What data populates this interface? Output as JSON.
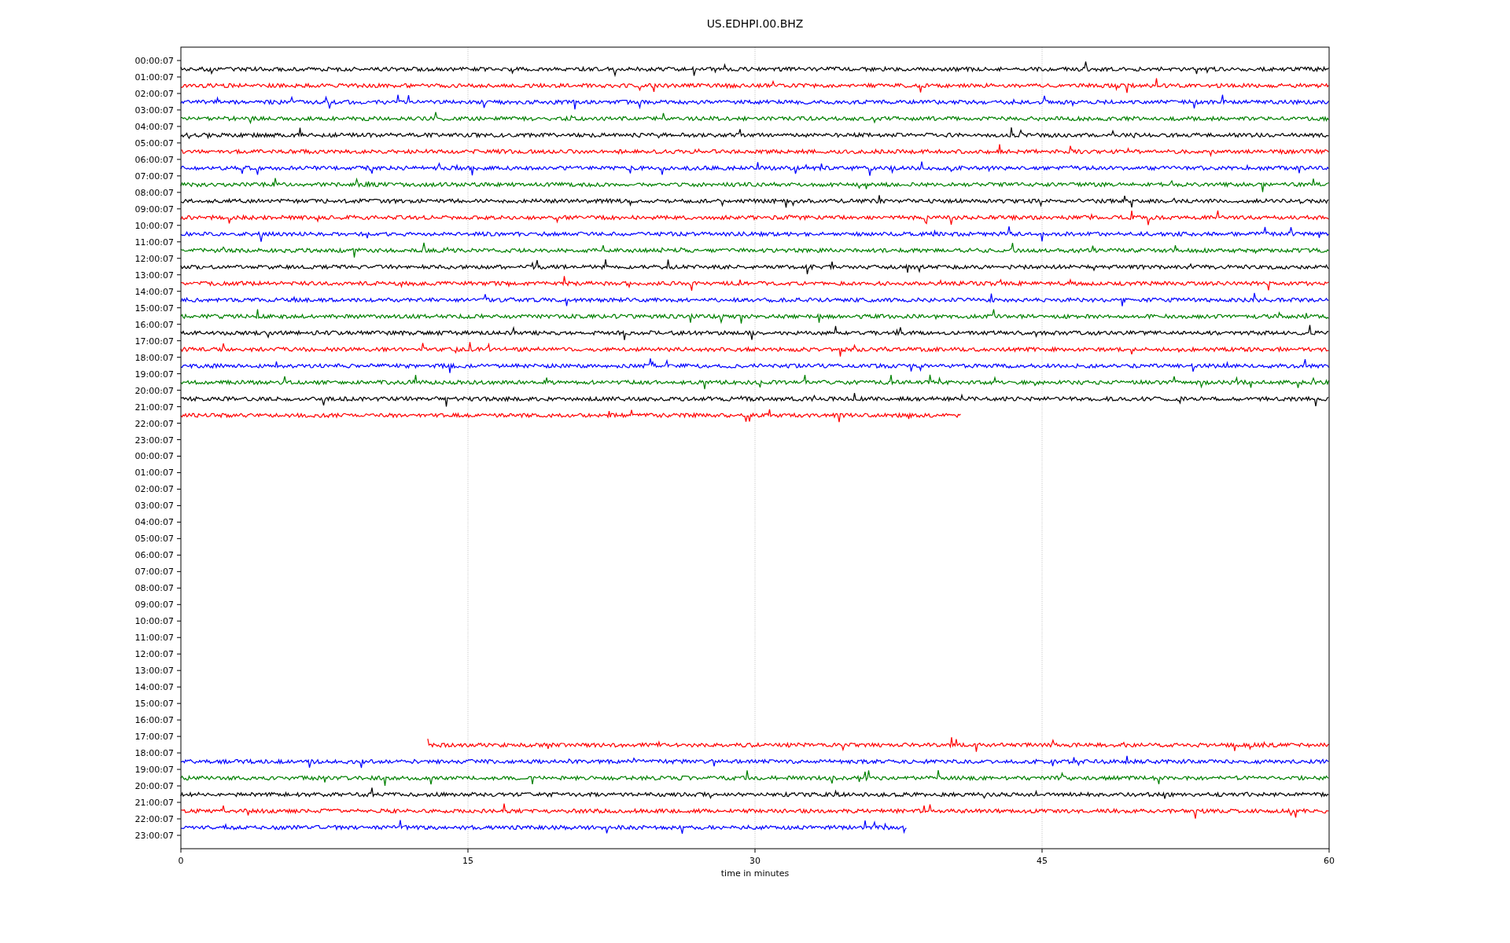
{
  "title": "US.EDHPI.00.BHZ",
  "xlabel": "time in minutes",
  "xticks": [
    "0",
    "15",
    "30",
    "45",
    "60"
  ],
  "rows": [
    {
      "label": "00:00:07",
      "trace": {
        "kind": "full",
        "color": "#000000",
        "level": 1
      }
    },
    {
      "label": "01:00:07",
      "trace": {
        "kind": "full",
        "color": "#ff0000",
        "level": 1
      }
    },
    {
      "label": "02:00:07",
      "trace": {
        "kind": "full",
        "color": "#0000ff",
        "level": 1
      }
    },
    {
      "label": "03:00:07",
      "trace": {
        "kind": "full",
        "color": "#008000",
        "level": 1
      }
    },
    {
      "label": "04:00:07",
      "trace": {
        "kind": "full",
        "color": "#000000",
        "level": 1
      }
    },
    {
      "label": "05:00:07",
      "trace": {
        "kind": "full",
        "color": "#ff0000",
        "level": 1
      }
    },
    {
      "label": "06:00:07",
      "trace": {
        "kind": "full",
        "color": "#0000ff",
        "level": 1
      }
    },
    {
      "label": "07:00:07",
      "trace": {
        "kind": "full",
        "color": "#008000",
        "level": 1
      }
    },
    {
      "label": "08:00:07",
      "trace": {
        "kind": "full",
        "color": "#000000",
        "level": 1
      }
    },
    {
      "label": "09:00:07",
      "trace": {
        "kind": "full",
        "color": "#ff0000",
        "level": 1
      }
    },
    {
      "label": "10:00:07",
      "trace": {
        "kind": "full",
        "color": "#0000ff",
        "level": 1
      }
    },
    {
      "label": "11:00:07",
      "trace": {
        "kind": "full",
        "color": "#008000",
        "level": 1
      }
    },
    {
      "label": "12:00:07",
      "trace": {
        "kind": "full",
        "color": "#000000",
        "level": 1
      }
    },
    {
      "label": "13:00:07",
      "trace": {
        "kind": "full",
        "color": "#ff0000",
        "level": 1
      }
    },
    {
      "label": "14:00:07",
      "trace": {
        "kind": "full",
        "color": "#0000ff",
        "level": 1
      }
    },
    {
      "label": "15:00:07",
      "trace": {
        "kind": "full",
        "color": "#008000",
        "level": 1
      }
    },
    {
      "label": "16:00:07",
      "trace": {
        "kind": "full",
        "color": "#000000",
        "level": 1
      }
    },
    {
      "label": "17:00:07",
      "trace": {
        "kind": "full",
        "color": "#ff0000",
        "level": 1
      }
    },
    {
      "label": "18:00:07",
      "trace": {
        "kind": "full",
        "color": "#0000ff",
        "level": 1
      }
    },
    {
      "label": "19:00:07",
      "trace": {
        "kind": "full",
        "color": "#008000",
        "level": 1
      }
    },
    {
      "label": "20:00:07",
      "trace": {
        "kind": "full",
        "color": "#000000",
        "level": 1
      }
    },
    {
      "label": "21:00:07",
      "trace": {
        "kind": "early",
        "color": "#ff0000",
        "level": 0.68
      }
    },
    {
      "label": "22:00:07"
    },
    {
      "label": "23:00:07"
    },
    {
      "label": "00:00:07"
    },
    {
      "label": "01:00:07"
    },
    {
      "label": "02:00:07"
    },
    {
      "label": "03:00:07"
    },
    {
      "label": "04:00:07"
    },
    {
      "label": "05:00:07"
    },
    {
      "label": "06:00:07"
    },
    {
      "label": "07:00:07"
    },
    {
      "label": "08:00:07"
    },
    {
      "label": "09:00:07"
    },
    {
      "label": "10:00:07"
    },
    {
      "label": "11:00:07"
    },
    {
      "label": "12:00:07"
    },
    {
      "label": "13:00:07"
    },
    {
      "label": "14:00:07"
    },
    {
      "label": "15:00:07"
    },
    {
      "label": "16:00:07"
    },
    {
      "label": "17:00:07",
      "trace": {
        "kind": "late",
        "color": "#ff0000",
        "level": 0.785
      }
    },
    {
      "label": "18:00:07",
      "trace": {
        "kind": "full",
        "color": "#0000ff",
        "level": 1
      }
    },
    {
      "label": "19:00:07",
      "trace": {
        "kind": "full",
        "color": "#008000",
        "level": 1
      }
    },
    {
      "label": "20:00:07",
      "trace": {
        "kind": "full",
        "color": "#000000",
        "level": 1
      }
    },
    {
      "label": "21:00:07",
      "trace": {
        "kind": "full",
        "color": "#ff0000",
        "level": 1
      }
    },
    {
      "label": "22:00:07",
      "trace": {
        "kind": "early",
        "color": "#0000ff",
        "level": 0.632
      }
    },
    {
      "label": "23:00:07"
    }
  ]
}
